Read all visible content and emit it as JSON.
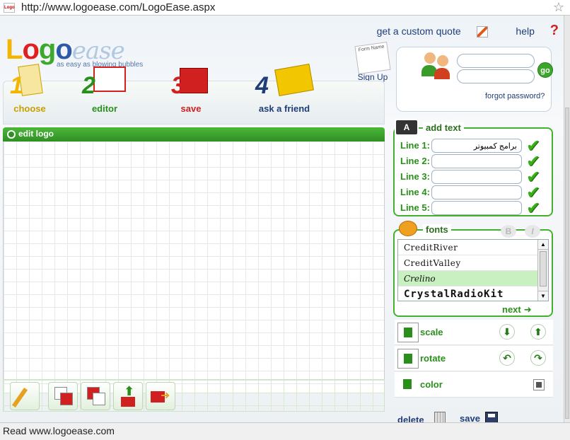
{
  "browser": {
    "url": "http://www.logoease.com/LogoEase.aspx",
    "favicon_text": "Logo",
    "status": "Read www.logoease.com"
  },
  "brand": {
    "logo_letters": [
      "L",
      "o",
      "g",
      "o"
    ],
    "logo_script": "ease",
    "tagline": "as easy as blowing bubbles"
  },
  "toplinks": {
    "quote": "get a custom quote",
    "help": "help",
    "help_mark": "?"
  },
  "signup": {
    "label": "Sign Up",
    "form_text": "Form Name"
  },
  "login": {
    "forgot": "forgot password?",
    "go": "go"
  },
  "steps": [
    {
      "num": "1",
      "label": "choose",
      "color": "#f2b600"
    },
    {
      "num": "2",
      "label": "editor",
      "color": "#2a8f1a"
    },
    {
      "num": "3",
      "label": "save",
      "color": "#d02020"
    },
    {
      "num": "4",
      "label": "ask a friend",
      "color": "#1f3d7a"
    }
  ],
  "editor": {
    "title": "edit logo"
  },
  "add_text": {
    "title": "add text",
    "lines": [
      {
        "label": "Line 1:",
        "value": "برامج كمبيوتر"
      },
      {
        "label": "Line 2:",
        "value": ""
      },
      {
        "label": "Line 3:",
        "value": ""
      },
      {
        "label": "Line 4:",
        "value": ""
      },
      {
        "label": "Line 5:",
        "value": ""
      }
    ],
    "check": "✔"
  },
  "fonts": {
    "title": "fonts",
    "bold": "B",
    "italic": "I",
    "items": [
      "CreditRiver",
      "CreditValley",
      "Crelino",
      "CrystalRadioKit"
    ],
    "selected": "Crelino",
    "next": "next",
    "next_arrow": "➜"
  },
  "controls": {
    "scale": "scale",
    "rotate": "rotate",
    "color": "color",
    "down_arrow": "⬇",
    "up_arrow": "⬆",
    "rot_left": "↶",
    "rot_right": "↷"
  },
  "actions": {
    "delete": "delete",
    "save": "save"
  },
  "colors": {
    "accent_green": "#43b02f",
    "link_blue": "#1f3d7a"
  }
}
